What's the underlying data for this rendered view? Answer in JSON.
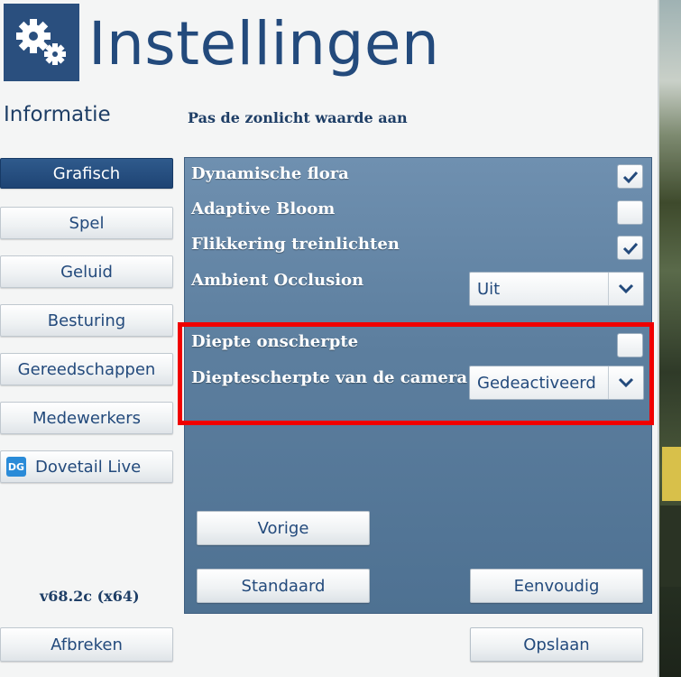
{
  "header": {
    "title": "Instellingen",
    "logo_icon": "gears-icon"
  },
  "info_heading": "Informatie",
  "hint": "Pas de zonlicht waarde aan",
  "sidebar": {
    "items": [
      {
        "label": "Grafisch",
        "active": true
      },
      {
        "label": "Spel",
        "active": false
      },
      {
        "label": "Geluid",
        "active": false
      },
      {
        "label": "Besturing",
        "active": false
      },
      {
        "label": "Gereedschappen",
        "active": false
      },
      {
        "label": "Medewerkers",
        "active": false
      },
      {
        "label": "Dovetail Live",
        "active": false,
        "icon": "dovetail-live-icon"
      }
    ]
  },
  "version": "v68.2c (x64)",
  "options": [
    {
      "label": "Dynamische flora",
      "type": "checkbox",
      "checked": true
    },
    {
      "label": "Adaptive Bloom",
      "type": "checkbox",
      "checked": false
    },
    {
      "label": "Flikkering treinlichten",
      "type": "checkbox",
      "checked": true
    },
    {
      "label": "Ambient Occlusion",
      "type": "select",
      "value": "Uit"
    },
    {
      "label": "Diepte onscherpte",
      "type": "checkbox",
      "checked": false
    },
    {
      "label": "Dieptescherpte van de camera",
      "type": "select",
      "value": "Gedeactiveerd"
    }
  ],
  "buttons": {
    "previous": "Vorige",
    "default": "Standaard",
    "simple": "Eenvoudig",
    "cancel": "Afbreken",
    "save": "Opslaan"
  },
  "colors": {
    "accent": "#234a7c",
    "panel": "#5d7f9f",
    "highlight": "#f00000"
  }
}
